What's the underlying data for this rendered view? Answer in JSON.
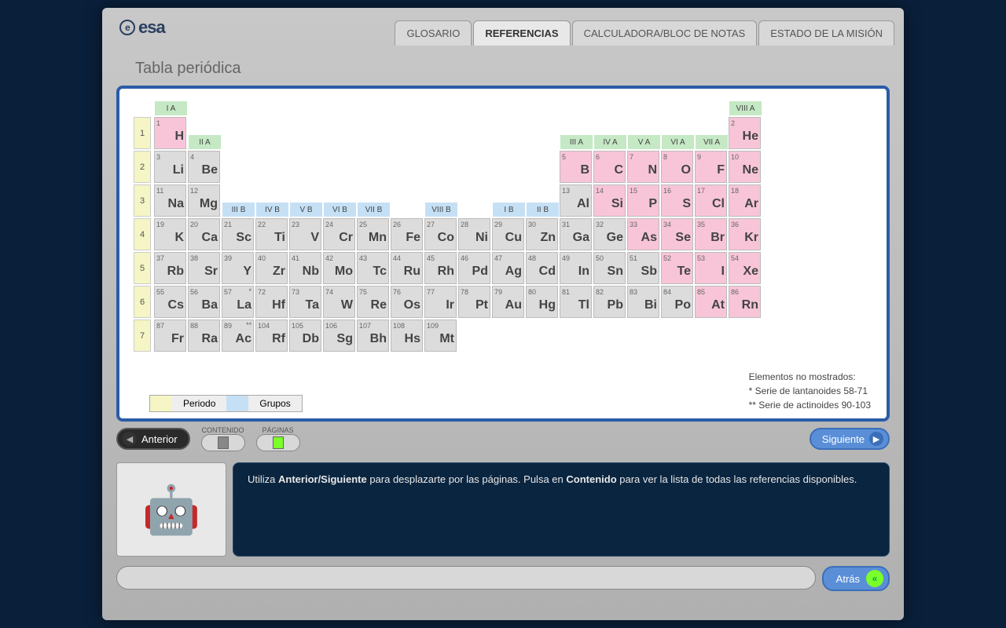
{
  "logo": "esa",
  "tabs": [
    "GLOSARIO",
    "REFERENCIAS",
    "CALCULADORA/BLOC DE NOTAS",
    "ESTADO DE LA MISIÓN"
  ],
  "active_tab": 1,
  "title": "Tabla periódica",
  "group_labels": [
    {
      "txt": "I A",
      "col": 0,
      "row": -1,
      "cls": ""
    },
    {
      "txt": "II A",
      "col": 1,
      "row": 0,
      "cls": ""
    },
    {
      "txt": "III A",
      "col": 12,
      "row": 0,
      "cls": ""
    },
    {
      "txt": "IV A",
      "col": 13,
      "row": 0,
      "cls": ""
    },
    {
      "txt": "V A",
      "col": 14,
      "row": 0,
      "cls": ""
    },
    {
      "txt": "VI A",
      "col": 15,
      "row": 0,
      "cls": ""
    },
    {
      "txt": "VII A",
      "col": 16,
      "row": 0,
      "cls": ""
    },
    {
      "txt": "VIII A",
      "col": 17,
      "row": -1,
      "cls": ""
    },
    {
      "txt": "III B",
      "col": 2,
      "row": 2,
      "cls": "blue"
    },
    {
      "txt": "IV B",
      "col": 3,
      "row": 2,
      "cls": "blue"
    },
    {
      "txt": "V B",
      "col": 4,
      "row": 2,
      "cls": "blue"
    },
    {
      "txt": "VI B",
      "col": 5,
      "row": 2,
      "cls": "blue"
    },
    {
      "txt": "VII B",
      "col": 6,
      "row": 2,
      "cls": "blue"
    },
    {
      "txt": "VIII B",
      "col": 8,
      "row": 2,
      "cls": "blue"
    },
    {
      "txt": "I B",
      "col": 10,
      "row": 2,
      "cls": "blue"
    },
    {
      "txt": "II B",
      "col": 11,
      "row": 2,
      "cls": "blue"
    }
  ],
  "periods": [
    1,
    2,
    3,
    4,
    5,
    6,
    7
  ],
  "elements": [
    {
      "n": 1,
      "s": "H",
      "r": 0,
      "c": 0,
      "k": "pink"
    },
    {
      "n": 2,
      "s": "He",
      "r": 0,
      "c": 17,
      "k": "pink"
    },
    {
      "n": 3,
      "s": "Li",
      "r": 1,
      "c": 0,
      "k": ""
    },
    {
      "n": 4,
      "s": "Be",
      "r": 1,
      "c": 1,
      "k": ""
    },
    {
      "n": 5,
      "s": "B",
      "r": 1,
      "c": 12,
      "k": "pink"
    },
    {
      "n": 6,
      "s": "C",
      "r": 1,
      "c": 13,
      "k": "pink"
    },
    {
      "n": 7,
      "s": "N",
      "r": 1,
      "c": 14,
      "k": "pink"
    },
    {
      "n": 8,
      "s": "O",
      "r": 1,
      "c": 15,
      "k": "pink"
    },
    {
      "n": 9,
      "s": "F",
      "r": 1,
      "c": 16,
      "k": "pink"
    },
    {
      "n": 10,
      "s": "Ne",
      "r": 1,
      "c": 17,
      "k": "pink"
    },
    {
      "n": 11,
      "s": "Na",
      "r": 2,
      "c": 0,
      "k": ""
    },
    {
      "n": 12,
      "s": "Mg",
      "r": 2,
      "c": 1,
      "k": ""
    },
    {
      "n": 13,
      "s": "Al",
      "r": 2,
      "c": 12,
      "k": ""
    },
    {
      "n": 14,
      "s": "Si",
      "r": 2,
      "c": 13,
      "k": "pink"
    },
    {
      "n": 15,
      "s": "P",
      "r": 2,
      "c": 14,
      "k": "pink"
    },
    {
      "n": 16,
      "s": "S",
      "r": 2,
      "c": 15,
      "k": "pink"
    },
    {
      "n": 17,
      "s": "Cl",
      "r": 2,
      "c": 16,
      "k": "pink"
    },
    {
      "n": 18,
      "s": "Ar",
      "r": 2,
      "c": 17,
      "k": "pink"
    },
    {
      "n": 19,
      "s": "K",
      "r": 3,
      "c": 0,
      "k": ""
    },
    {
      "n": 20,
      "s": "Ca",
      "r": 3,
      "c": 1,
      "k": ""
    },
    {
      "n": 21,
      "s": "Sc",
      "r": 3,
      "c": 2,
      "k": ""
    },
    {
      "n": 22,
      "s": "Ti",
      "r": 3,
      "c": 3,
      "k": ""
    },
    {
      "n": 23,
      "s": "V",
      "r": 3,
      "c": 4,
      "k": ""
    },
    {
      "n": 24,
      "s": "Cr",
      "r": 3,
      "c": 5,
      "k": ""
    },
    {
      "n": 25,
      "s": "Mn",
      "r": 3,
      "c": 6,
      "k": ""
    },
    {
      "n": 26,
      "s": "Fe",
      "r": 3,
      "c": 7,
      "k": ""
    },
    {
      "n": 27,
      "s": "Co",
      "r": 3,
      "c": 8,
      "k": ""
    },
    {
      "n": 28,
      "s": "Ni",
      "r": 3,
      "c": 9,
      "k": ""
    },
    {
      "n": 29,
      "s": "Cu",
      "r": 3,
      "c": 10,
      "k": ""
    },
    {
      "n": 30,
      "s": "Zn",
      "r": 3,
      "c": 11,
      "k": ""
    },
    {
      "n": 31,
      "s": "Ga",
      "r": 3,
      "c": 12,
      "k": ""
    },
    {
      "n": 32,
      "s": "Ge",
      "r": 3,
      "c": 13,
      "k": ""
    },
    {
      "n": 33,
      "s": "As",
      "r": 3,
      "c": 14,
      "k": "pink"
    },
    {
      "n": 34,
      "s": "Se",
      "r": 3,
      "c": 15,
      "k": "pink"
    },
    {
      "n": 35,
      "s": "Br",
      "r": 3,
      "c": 16,
      "k": "pink"
    },
    {
      "n": 36,
      "s": "Kr",
      "r": 3,
      "c": 17,
      "k": "pink"
    },
    {
      "n": 37,
      "s": "Rb",
      "r": 4,
      "c": 0,
      "k": ""
    },
    {
      "n": 38,
      "s": "Sr",
      "r": 4,
      "c": 1,
      "k": ""
    },
    {
      "n": 39,
      "s": "Y",
      "r": 4,
      "c": 2,
      "k": ""
    },
    {
      "n": 40,
      "s": "Zr",
      "r": 4,
      "c": 3,
      "k": ""
    },
    {
      "n": 41,
      "s": "Nb",
      "r": 4,
      "c": 4,
      "k": ""
    },
    {
      "n": 42,
      "s": "Mo",
      "r": 4,
      "c": 5,
      "k": ""
    },
    {
      "n": 43,
      "s": "Tc",
      "r": 4,
      "c": 6,
      "k": ""
    },
    {
      "n": 44,
      "s": "Ru",
      "r": 4,
      "c": 7,
      "k": ""
    },
    {
      "n": 45,
      "s": "Rh",
      "r": 4,
      "c": 8,
      "k": ""
    },
    {
      "n": 46,
      "s": "Pd",
      "r": 4,
      "c": 9,
      "k": ""
    },
    {
      "n": 47,
      "s": "Ag",
      "r": 4,
      "c": 10,
      "k": ""
    },
    {
      "n": 48,
      "s": "Cd",
      "r": 4,
      "c": 11,
      "k": ""
    },
    {
      "n": 49,
      "s": "In",
      "r": 4,
      "c": 12,
      "k": ""
    },
    {
      "n": 50,
      "s": "Sn",
      "r": 4,
      "c": 13,
      "k": ""
    },
    {
      "n": 51,
      "s": "Sb",
      "r": 4,
      "c": 14,
      "k": ""
    },
    {
      "n": 52,
      "s": "Te",
      "r": 4,
      "c": 15,
      "k": "pink"
    },
    {
      "n": 53,
      "s": "I",
      "r": 4,
      "c": 16,
      "k": "pink"
    },
    {
      "n": 54,
      "s": "Xe",
      "r": 4,
      "c": 17,
      "k": "pink"
    },
    {
      "n": 55,
      "s": "Cs",
      "r": 5,
      "c": 0,
      "k": ""
    },
    {
      "n": 56,
      "s": "Ba",
      "r": 5,
      "c": 1,
      "k": ""
    },
    {
      "n": 57,
      "s": "La",
      "r": 5,
      "c": 2,
      "k": "",
      "star": "*"
    },
    {
      "n": 72,
      "s": "Hf",
      "r": 5,
      "c": 3,
      "k": ""
    },
    {
      "n": 73,
      "s": "Ta",
      "r": 5,
      "c": 4,
      "k": ""
    },
    {
      "n": 74,
      "s": "W",
      "r": 5,
      "c": 5,
      "k": ""
    },
    {
      "n": 75,
      "s": "Re",
      "r": 5,
      "c": 6,
      "k": ""
    },
    {
      "n": 76,
      "s": "Os",
      "r": 5,
      "c": 7,
      "k": ""
    },
    {
      "n": 77,
      "s": "Ir",
      "r": 5,
      "c": 8,
      "k": ""
    },
    {
      "n": 78,
      "s": "Pt",
      "r": 5,
      "c": 9,
      "k": ""
    },
    {
      "n": 79,
      "s": "Au",
      "r": 5,
      "c": 10,
      "k": ""
    },
    {
      "n": 80,
      "s": "Hg",
      "r": 5,
      "c": 11,
      "k": ""
    },
    {
      "n": 81,
      "s": "Tl",
      "r": 5,
      "c": 12,
      "k": ""
    },
    {
      "n": 82,
      "s": "Pb",
      "r": 5,
      "c": 13,
      "k": ""
    },
    {
      "n": 83,
      "s": "Bi",
      "r": 5,
      "c": 14,
      "k": ""
    },
    {
      "n": 84,
      "s": "Po",
      "r": 5,
      "c": 15,
      "k": ""
    },
    {
      "n": 85,
      "s": "At",
      "r": 5,
      "c": 16,
      "k": "pink"
    },
    {
      "n": 86,
      "s": "Rn",
      "r": 5,
      "c": 17,
      "k": "pink"
    },
    {
      "n": 87,
      "s": "Fr",
      "r": 6,
      "c": 0,
      "k": ""
    },
    {
      "n": 88,
      "s": "Ra",
      "r": 6,
      "c": 1,
      "k": ""
    },
    {
      "n": 89,
      "s": "Ac",
      "r": 6,
      "c": 2,
      "k": "",
      "star": "**"
    },
    {
      "n": 104,
      "s": "Rf",
      "r": 6,
      "c": 3,
      "k": ""
    },
    {
      "n": 105,
      "s": "Db",
      "r": 6,
      "c": 4,
      "k": ""
    },
    {
      "n": 106,
      "s": "Sg",
      "r": 6,
      "c": 5,
      "k": ""
    },
    {
      "n": 107,
      "s": "Bh",
      "r": 6,
      "c": 6,
      "k": ""
    },
    {
      "n": 108,
      "s": "Hs",
      "r": 6,
      "c": 7,
      "k": ""
    },
    {
      "n": 109,
      "s": "Mt",
      "r": 6,
      "c": 8,
      "k": ""
    }
  ],
  "legend": {
    "period": "Periodo",
    "groups": "Grupos"
  },
  "notes": {
    "title": "Elementos no mostrados:",
    "l1": "*  Serie de lantanoides 58-71",
    "l2": "** Serie de actinoides 90-103"
  },
  "nav": {
    "prev": "Anterior",
    "next": "Siguiente",
    "contenido": "CONTENIDO",
    "paginas": "PÁGINAS",
    "back": "Atrás"
  },
  "help": {
    "p1": "Utiliza ",
    "b1": "Anterior/Siguiente",
    "p2": " para desplazarte por las páginas. Pulsa en ",
    "b2": "Contenido",
    "p3": " para ver la lista de todas las referencias disponibles."
  }
}
